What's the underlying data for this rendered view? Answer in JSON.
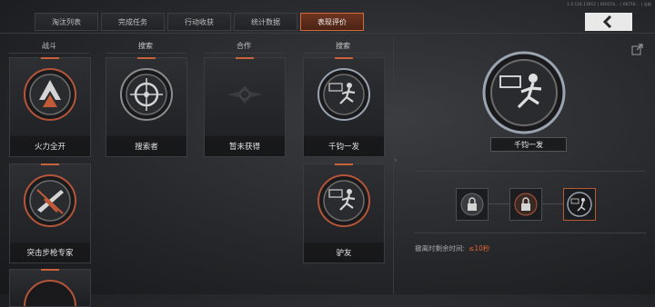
{
  "version_text": "1.0.124.13912 | 060216... | 66716... | 当前",
  "tabs": [
    {
      "label": "淘汰列表"
    },
    {
      "label": "完成任务"
    },
    {
      "label": "行动收获"
    },
    {
      "label": "统计数据"
    },
    {
      "label": "表现评价",
      "active": true
    }
  ],
  "columns": [
    {
      "header": "战斗"
    },
    {
      "header": "搜索"
    },
    {
      "header": "合作"
    },
    {
      "header": "搜索"
    }
  ],
  "cards": [
    {
      "label": "火力全开",
      "medal": "flame-chevron-icon"
    },
    {
      "label": "突击步枪专家",
      "medal": "rifle-icon"
    },
    {
      "label": "搜索者",
      "medal": "crosshair-scope-icon"
    },
    {
      "label": "暂未获得",
      "medal": "locked-emblem-icon"
    },
    {
      "label": "千钧一发",
      "medal": "running-man-timer-icon"
    },
    {
      "label": "驴友",
      "medal": "running-man-timer-icon"
    }
  ],
  "detail": {
    "title": "千钧一发",
    "timer_label": "撤离时剩余时间:",
    "timer_value": "≤10秒"
  },
  "colors": {
    "accent": "#d06a3a",
    "timer": "#e0632f"
  }
}
